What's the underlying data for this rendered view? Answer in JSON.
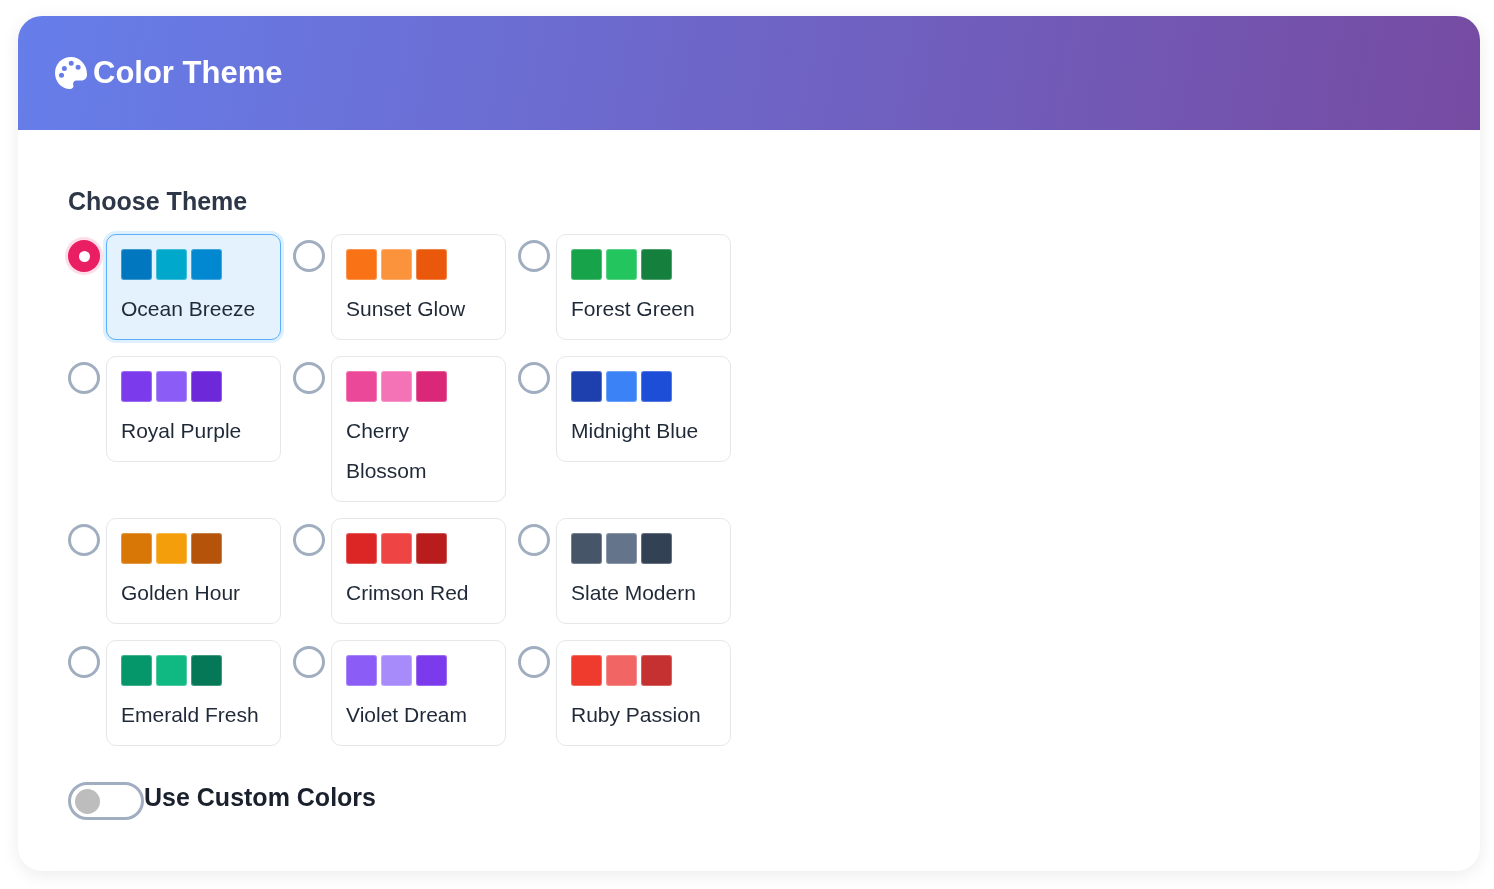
{
  "header": {
    "title": "Color Theme"
  },
  "section": {
    "heading": "Choose Theme"
  },
  "themes": [
    {
      "name": "Ocean Breeze",
      "selected": true,
      "swatches": [
        {
          "color": "#0077be"
        },
        {
          "color": "#00a8cc"
        },
        {
          "color": "#0288d1"
        }
      ]
    },
    {
      "name": "Sunset Glow",
      "selected": false,
      "swatches": [
        {
          "color": "#f97316"
        },
        {
          "color": "#fb923c"
        },
        {
          "color": "#ea580c"
        }
      ]
    },
    {
      "name": "Forest Green",
      "selected": false,
      "swatches": [
        {
          "color": "#16a34a"
        },
        {
          "color": "#22c55e"
        },
        {
          "color": "#15803d"
        }
      ]
    },
    {
      "name": "Royal Purple",
      "selected": false,
      "swatches": [
        {
          "color": "#7c3aed"
        },
        {
          "color": "#8b5cf6"
        },
        {
          "color": "#6d28d9"
        }
      ]
    },
    {
      "name": "Cherry Blossom",
      "selected": false,
      "swatches": [
        {
          "color": "#ec4899"
        },
        {
          "color": "#f472b6"
        },
        {
          "color": "#db2777"
        }
      ]
    },
    {
      "name": "Midnight Blue",
      "selected": false,
      "swatches": [
        {
          "color": "#1e40af"
        },
        {
          "color": "#3b82f6"
        },
        {
          "color": "#1d4ed8"
        }
      ]
    },
    {
      "name": "Golden Hour",
      "selected": false,
      "swatches": [
        {
          "color": "#d97706"
        },
        {
          "color": "#f59e0b"
        },
        {
          "color": "#b45309"
        }
      ]
    },
    {
      "name": "Crimson Red",
      "selected": false,
      "swatches": [
        {
          "color": "#dc2626"
        },
        {
          "color": "#ef4444"
        },
        {
          "color": "#b91c1c"
        }
      ]
    },
    {
      "name": "Slate Modern",
      "selected": false,
      "swatches": [
        {
          "color": "#475569"
        },
        {
          "color": "#64748b"
        },
        {
          "color": "#334155"
        }
      ]
    },
    {
      "name": "Emerald Fresh",
      "selected": false,
      "swatches": [
        {
          "color": "#059669"
        },
        {
          "color": "#10b981"
        },
        {
          "color": "#047857"
        }
      ]
    },
    {
      "name": "Violet Dream",
      "selected": false,
      "swatches": [
        {
          "color": "#8b5cf6"
        },
        {
          "color": "#a78bfa"
        },
        {
          "color": "#7c3aed"
        }
      ]
    },
    {
      "name": "Ruby Passion",
      "selected": false,
      "swatches": [
        {
          "color": "#ef3b2d"
        },
        {
          "color": "#f26565"
        },
        {
          "color": "#c53030"
        }
      ]
    }
  ],
  "custom_colors": {
    "label": "Use Custom Colors",
    "on": false
  }
}
